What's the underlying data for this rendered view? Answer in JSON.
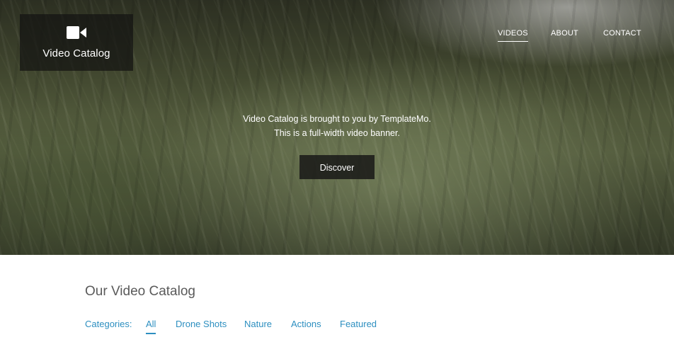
{
  "brand": {
    "title": "Video Catalog",
    "icon": "video-camera-icon"
  },
  "nav": {
    "items": [
      {
        "label": "VIDEOS",
        "active": true
      },
      {
        "label": "ABOUT",
        "active": false
      },
      {
        "label": "CONTACT",
        "active": false
      }
    ]
  },
  "hero": {
    "line1": "Video Catalog is brought to you by TemplateMo.",
    "line2": "This is a full-width video banner.",
    "button": "Discover"
  },
  "catalog": {
    "title": "Our Video Catalog",
    "categories_label": "Categories:",
    "categories": [
      {
        "label": "All",
        "active": true
      },
      {
        "label": "Drone Shots",
        "active": false
      },
      {
        "label": "Nature",
        "active": false
      },
      {
        "label": "Actions",
        "active": false
      },
      {
        "label": "Featured",
        "active": false
      }
    ]
  },
  "colors": {
    "accent": "#2d8fc0",
    "heading": "#5a5a5a"
  }
}
